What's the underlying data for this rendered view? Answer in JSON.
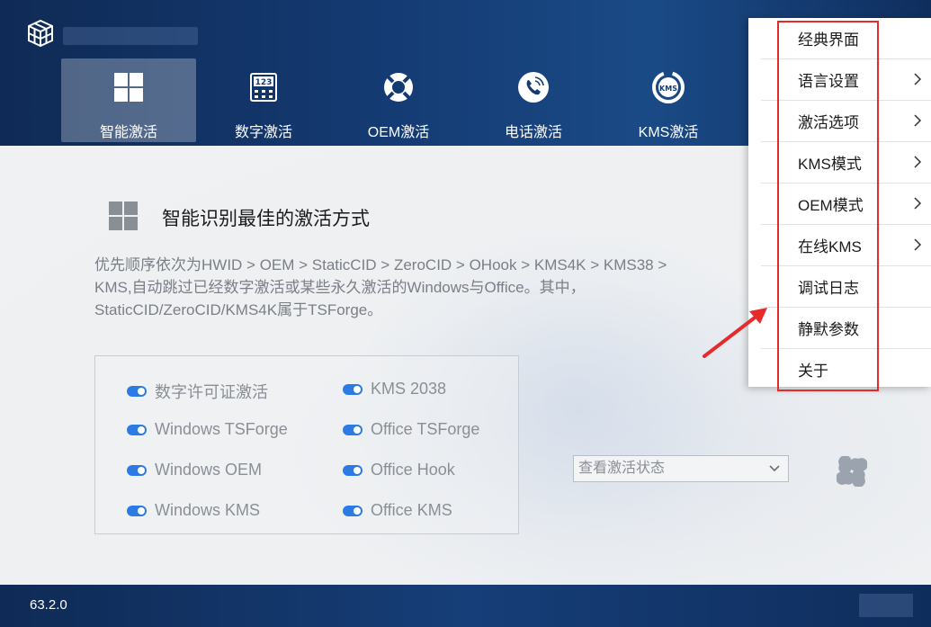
{
  "header": {
    "tabs": [
      {
        "label": "智能激活",
        "icon": "windows-logo-icon",
        "active": true
      },
      {
        "label": "数字激活",
        "icon": "digital-keypad-icon",
        "active": false
      },
      {
        "label": "OEM激活",
        "icon": "lifebuoy-icon",
        "active": false
      },
      {
        "label": "电话激活",
        "icon": "phone-icon",
        "active": false
      },
      {
        "label": "KMS激活",
        "icon": "kms-gauge-icon",
        "active": false
      }
    ]
  },
  "main": {
    "title": "智能识别最佳的激活方式",
    "description": "优先顺序依次为HWID > OEM > StaticCID > ZeroCID > OHook > KMS4K > KMS38 > KMS,自动跳过已经数字激活或某些永久激活的Windows与Office。其中，StaticCID/ZeroCID/KMS4K属于TSForge。",
    "options_left": [
      "数字许可证激活",
      "Windows TSForge",
      "Windows OEM",
      "Windows KMS"
    ],
    "options_right": [
      "KMS 2038",
      "Office TSForge",
      "Office Hook",
      "Office KMS"
    ],
    "status_select": "查看激活状态"
  },
  "footer": {
    "version": "63.2.0"
  },
  "menu": {
    "items": [
      {
        "label": "经典界面",
        "has_submenu": false
      },
      {
        "label": "语言设置",
        "has_submenu": true
      },
      {
        "label": "激活选项",
        "has_submenu": true
      },
      {
        "label": "KMS模式",
        "has_submenu": true
      },
      {
        "label": "OEM模式",
        "has_submenu": true
      },
      {
        "label": "在线KMS",
        "has_submenu": true
      },
      {
        "label": "调试日志",
        "has_submenu": false
      },
      {
        "label": "静默参数",
        "has_submenu": false
      },
      {
        "label": "关于",
        "has_submenu": false
      }
    ]
  },
  "colors": {
    "header_bg": "#143a72",
    "toggle_on": "#2c7be5",
    "annotation_red": "#e62b2b"
  }
}
